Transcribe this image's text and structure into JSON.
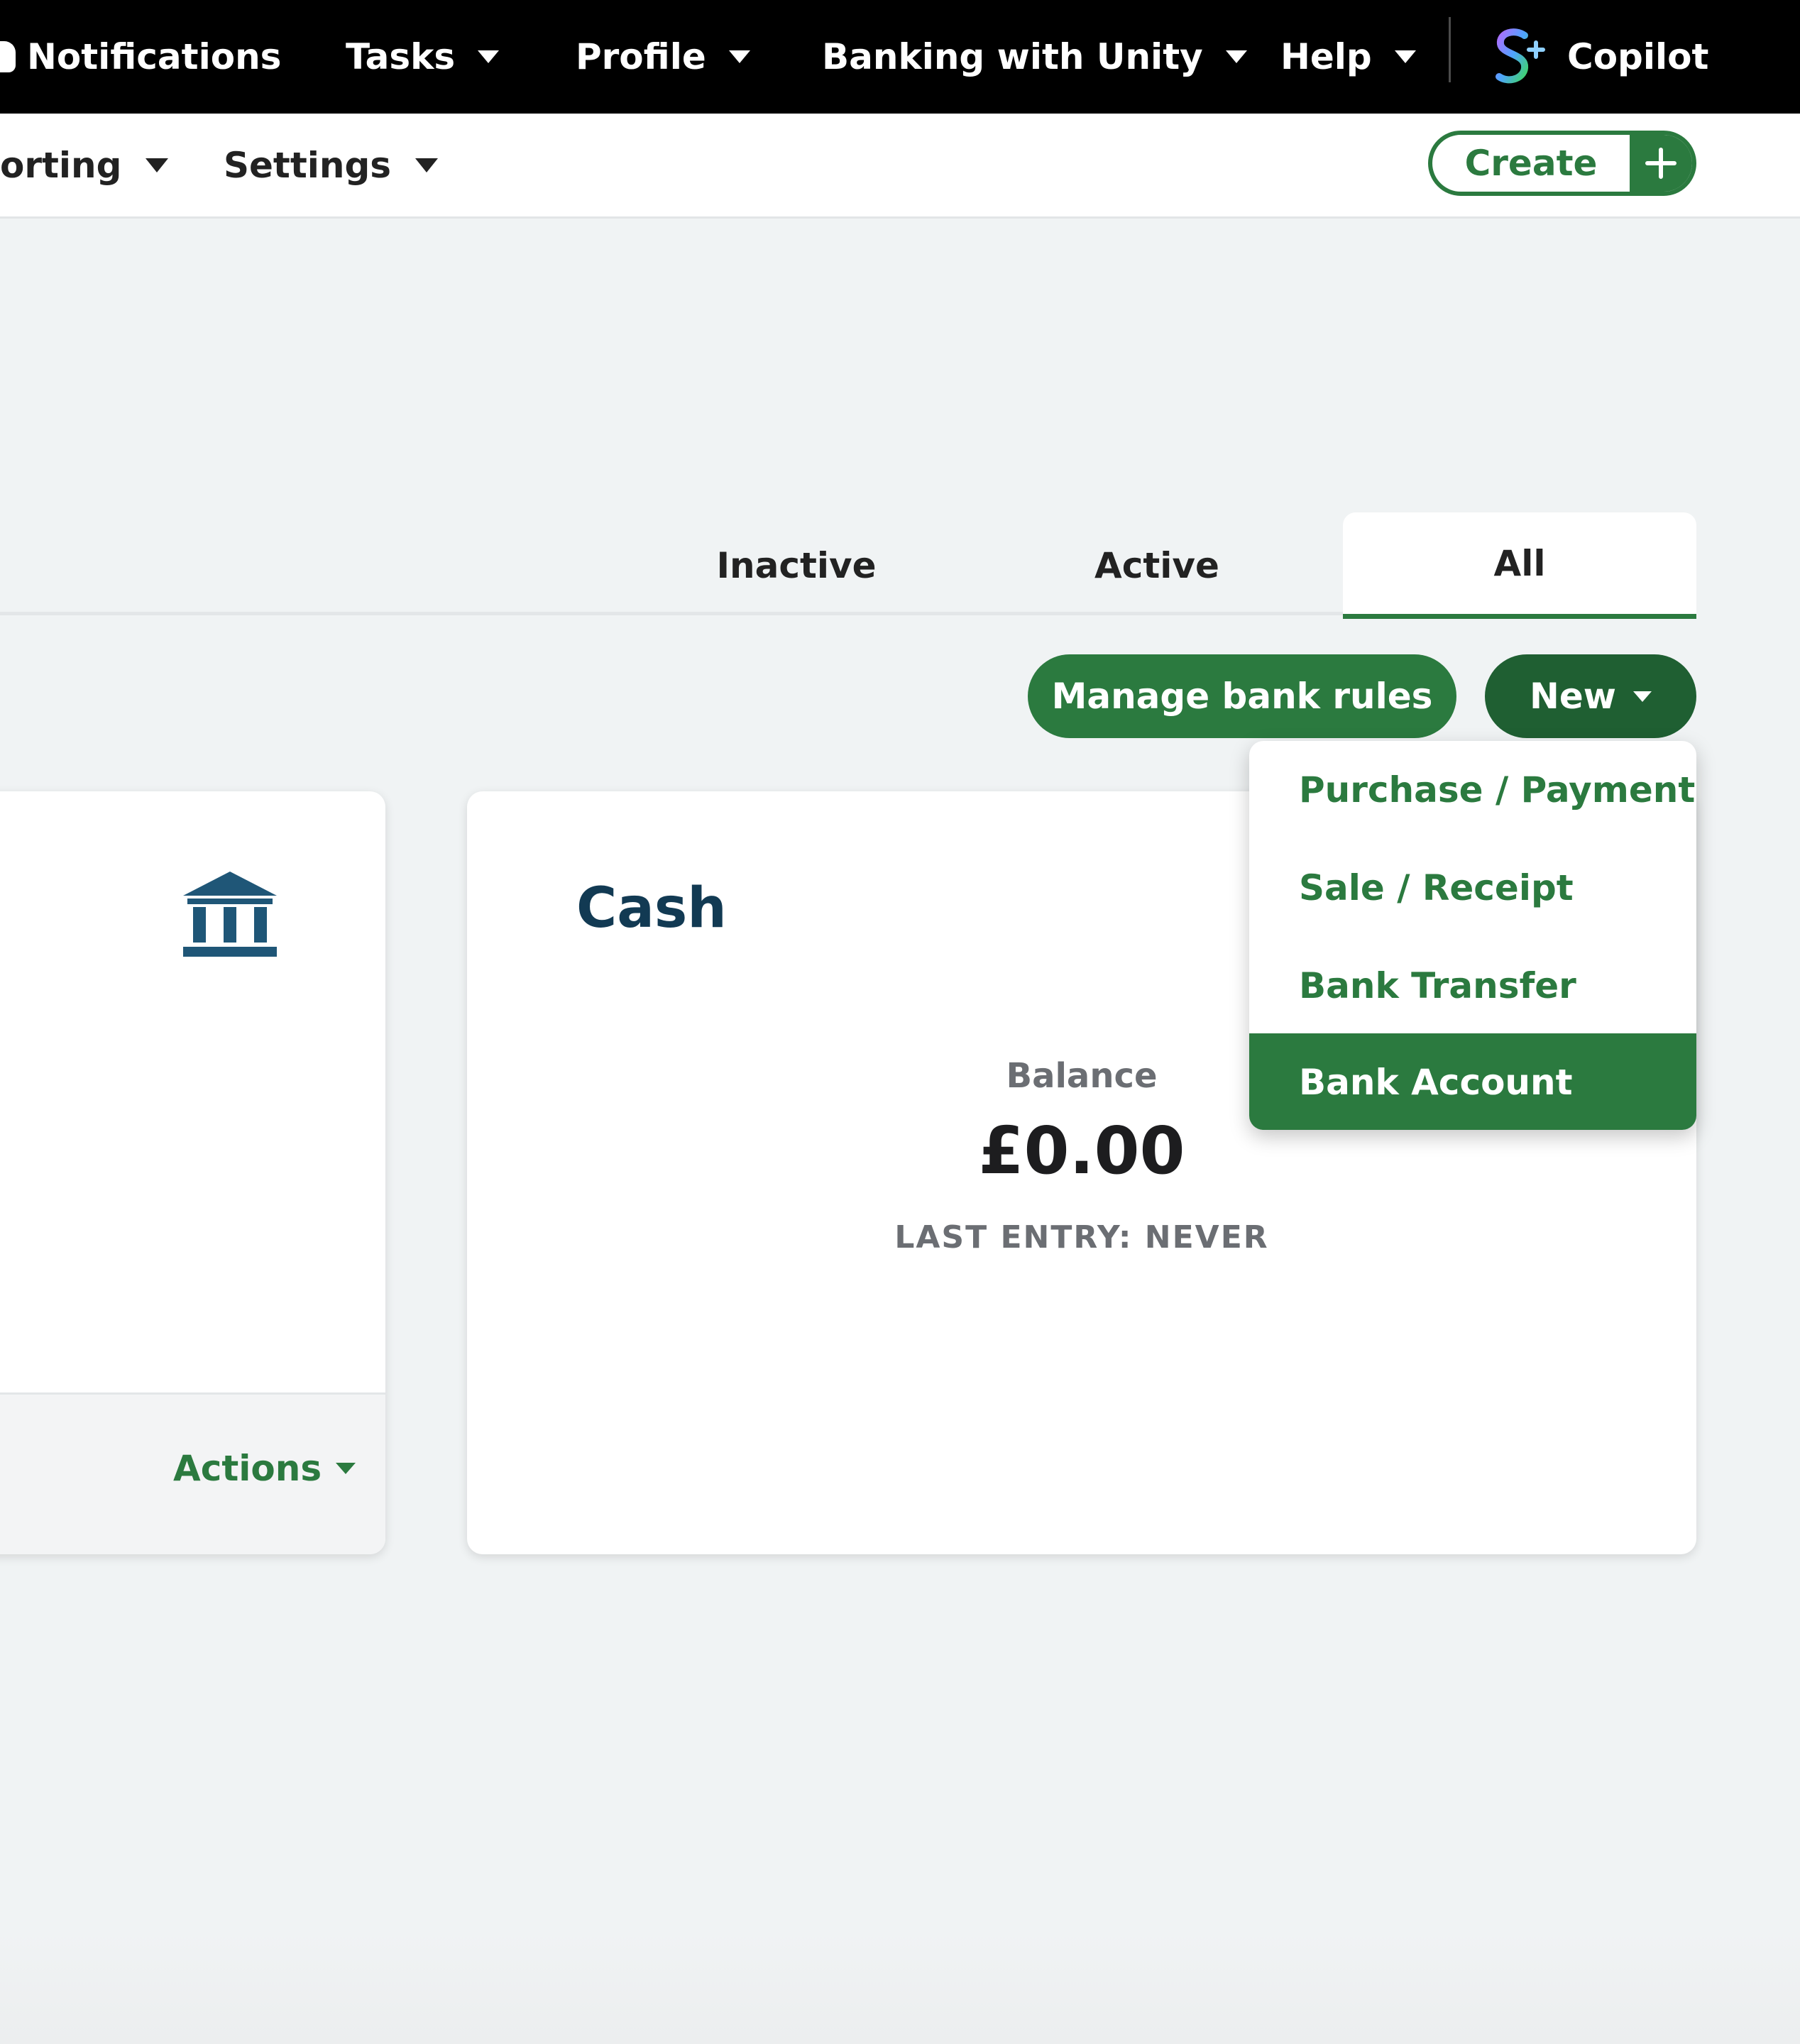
{
  "topbar": {
    "notifications": "Notifications",
    "tasks": "Tasks",
    "profile": "Profile",
    "banking": "Banking with Unity",
    "help": "Help",
    "copilot": "Copilot"
  },
  "subnav": {
    "reporting": "orting",
    "settings": "Settings",
    "create": "Create"
  },
  "tabs": {
    "inactive": "Inactive",
    "active": "Active",
    "all": "All"
  },
  "actions_bar": {
    "manage": "Manage bank rules",
    "new": "New"
  },
  "new_menu": {
    "items": [
      "Purchase / Payment",
      "Sale / Receipt",
      "Bank Transfer",
      "Bank Account"
    ],
    "selected": "Bank Account"
  },
  "cards": {
    "left": {
      "actions": "Actions"
    },
    "cash": {
      "title": "Cash",
      "balance_label": "Balance",
      "balance": "£0.00",
      "last_entry": "LAST ENTRY: NEVER"
    }
  },
  "icons": {
    "notifications": "bell-icon",
    "copilot": "copilot-icon",
    "create": "plus-icon",
    "card": "bank-icon"
  },
  "colors": {
    "accent": "#2b7a3f",
    "accent_dark": "#1f5f32",
    "title": "#123a53",
    "bank_icon": "#1f5677"
  }
}
